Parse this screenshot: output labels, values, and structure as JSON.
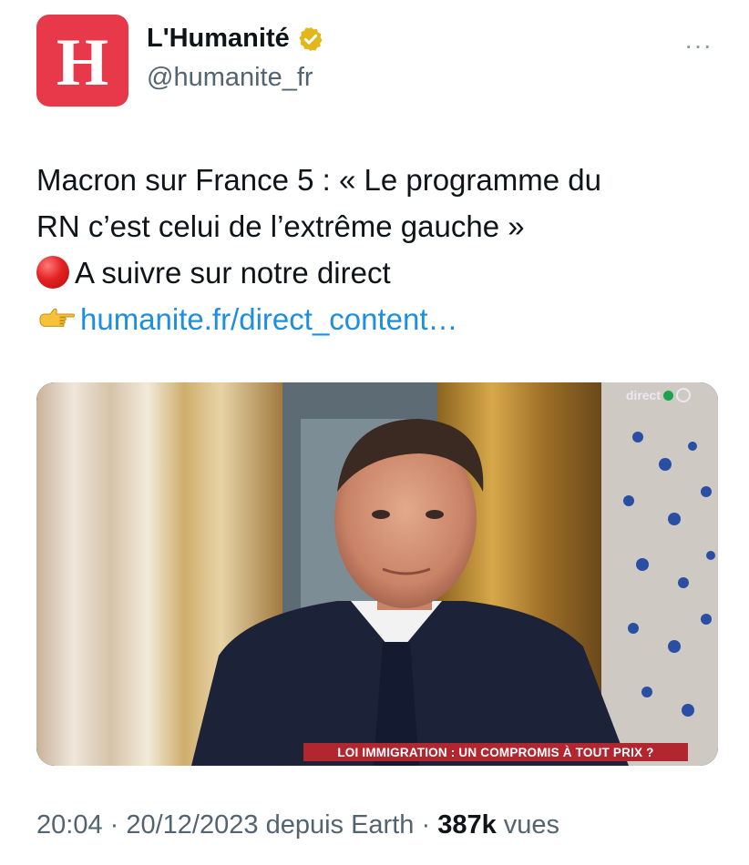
{
  "author": {
    "avatar_letter": "H",
    "display_name": "L'Humanité",
    "handle": "@humanite_fr",
    "verified": true,
    "avatar_color": "#e8394a",
    "badge_color": "#e2b719"
  },
  "more_label": "···",
  "tweet": {
    "line1": "Macron sur France 5 : « Le programme du",
    "line2": "RN c’est celui de l’extrême gauche »",
    "line3": "A suivre sur notre direct",
    "link": "humanite.fr/direct_content…"
  },
  "media": {
    "watermark": "direct",
    "banner": "LOI IMMIGRATION : UN COMPROMIS À TOUT PRIX ?"
  },
  "footer": {
    "time": "20:04",
    "sep1": " · ",
    "date": "20/12/2023",
    "source": " depuis Earth",
    "sep2": " · ",
    "views": "387k",
    "views_label": " vues"
  },
  "colors": {
    "link": "#1d8fe0",
    "secondary_text": "#536471",
    "banner": "#b2262f"
  }
}
